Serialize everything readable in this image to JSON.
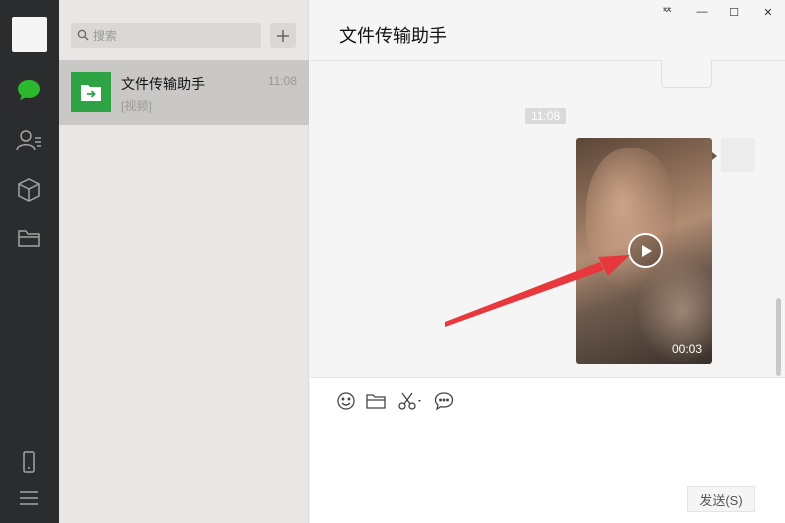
{
  "sidebar": {
    "icons": [
      "chat-icon",
      "contacts-icon",
      "favorites-icon",
      "files-icon",
      "phone-icon",
      "menu-icon"
    ],
    "accent_color": "#2cb82c"
  },
  "search": {
    "placeholder": "搜索"
  },
  "conversation_list": [
    {
      "name": "文件传输助手",
      "time": "11:08",
      "preview": "[视频]"
    }
  ],
  "chat": {
    "title": "文件传输助手",
    "time_divider": "11:08",
    "video_duration": "00:03"
  },
  "window_controls": {
    "pin": "ᅑ",
    "minimize": "—",
    "maximize": "☐",
    "close": "✕"
  },
  "toolbar": {
    "icons": [
      "emoji-icon",
      "folder-icon",
      "screenshot-icon",
      "chat-history-icon"
    ]
  },
  "composer": {
    "send_label": "发送(S)"
  }
}
